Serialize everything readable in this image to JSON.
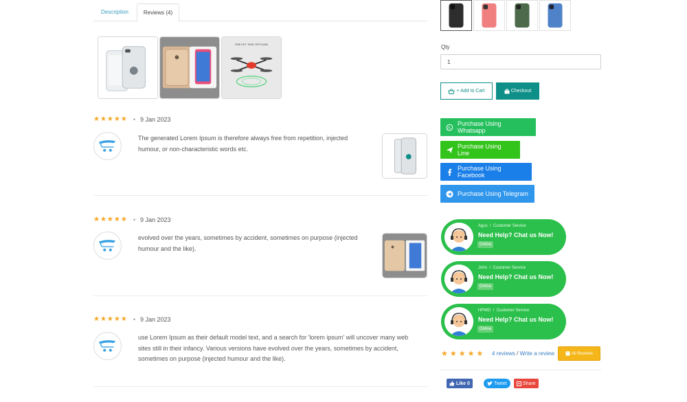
{
  "tabs": [
    {
      "label": "Description",
      "active": false
    },
    {
      "label": "Reviews (4)",
      "active": true
    }
  ],
  "reviews": [
    {
      "rating": 5,
      "stars": "★★★★★",
      "date": "9 Jan 2023",
      "lines": [
        "The generated Lorem Ipsum is therefore always free from repetition, injected",
        "humour, or non-characteristic words etc."
      ]
    },
    {
      "rating": 5,
      "stars": "★★★★★",
      "date": "9 Jan 2023",
      "lines": [
        "evolved over the years, sometimes by accident, sometimes on purpose (injected",
        "humour and the like)."
      ]
    },
    {
      "rating": 5,
      "stars": "★★★★★",
      "date": "9 Jan 2023",
      "lines": [
        "use Lorem Ipsum as their default model text, and a search for 'lorem ipsum' will uncover many web",
        "sites still in their infancy. Various versions have evolved over the years, sometimes by accident,",
        "sometimes on purpose (injected humour and the like)."
      ]
    }
  ],
  "product": {
    "qty_label": "Qty",
    "qty_value": "1",
    "add_to_cart_label": "+ Add to Cart",
    "checkout_label": "Checkout",
    "swatch_colors": [
      "#2d2d2d",
      "#f07f7f",
      "#4d6b4b",
      "#4f82c9"
    ]
  },
  "purchase": {
    "whatsapp": "Purchase Using Whatsapp",
    "line": "Purchase Using Line",
    "facebook": "Purchase Using Facebook",
    "telegram": "Purchase Using Telegram"
  },
  "chat_agents": [
    {
      "name": "Agus",
      "role": "Customer Service",
      "title": "Need Help? Chat us Now!",
      "status": "Online"
    },
    {
      "name": "John",
      "role": "Customer Service",
      "title": "Need Help? Chat us Now!",
      "status": "Online"
    },
    {
      "name": "HPWD",
      "role": "Customer Service",
      "title": "Need Help? Chat us Now!",
      "status": "Online"
    }
  ],
  "summary": {
    "rating": 5,
    "stars": "★★★★★",
    "reviews_link": "4 reviews",
    "separator": " / ",
    "write_link": "Write a review",
    "all_reviews_label": "All Reviews"
  },
  "social": {
    "like": "Like 0",
    "tweet": "Tweet",
    "share": "Share"
  },
  "colors": {
    "accent": "#0e8f87",
    "star": "#f5a623",
    "chat_green": "#2bbf4b",
    "whatsapp": "#25c05d",
    "line": "#33c41b",
    "facebook": "#1a7fe8",
    "telegram": "#2f96ec"
  }
}
